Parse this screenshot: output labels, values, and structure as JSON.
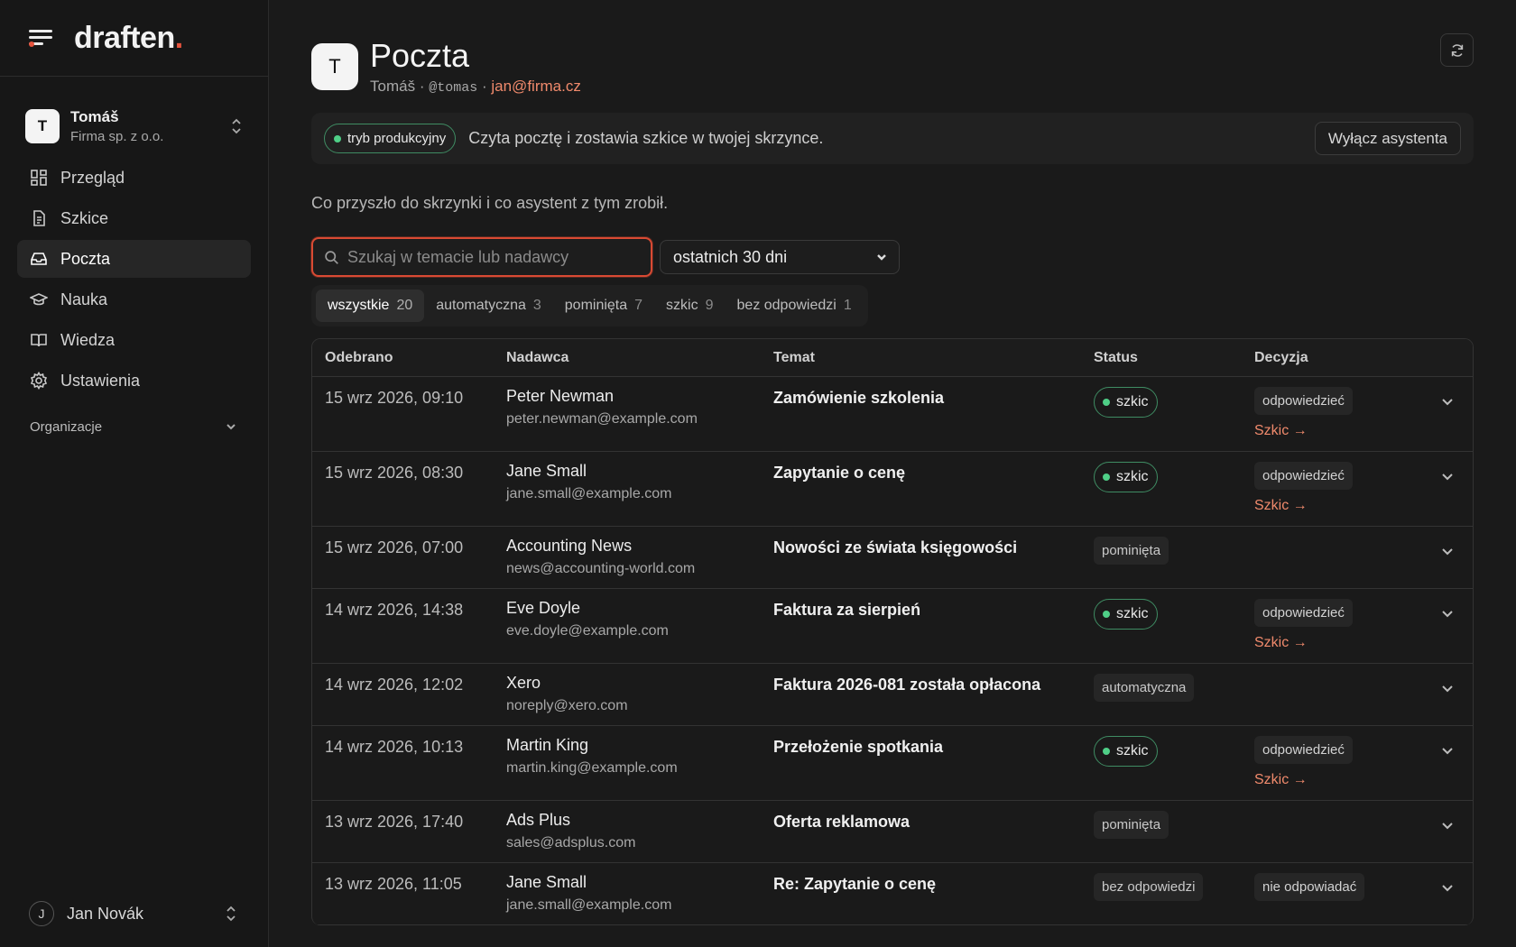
{
  "brand": {
    "name": "draften",
    "dot": "."
  },
  "org": {
    "initial": "T",
    "name": "Tomáš",
    "company": "Firma sp. z o.o."
  },
  "nav": [
    {
      "label": "Przegląd",
      "icon": "grid-icon",
      "active": false
    },
    {
      "label": "Szkice",
      "icon": "document-icon",
      "active": false
    },
    {
      "label": "Poczta",
      "icon": "inbox-icon",
      "active": true
    },
    {
      "label": "Nauka",
      "icon": "graduation-cap-icon",
      "active": false
    },
    {
      "label": "Wiedza",
      "icon": "book-icon",
      "active": false
    },
    {
      "label": "Ustawienia",
      "icon": "gear-icon",
      "active": false
    }
  ],
  "nav_section": "Organizacje",
  "user": {
    "initial": "J",
    "name": "Jan Novák"
  },
  "header": {
    "initial": "T",
    "title": "Poczta",
    "name": "Tomáš",
    "sep": "·",
    "handle": "@tomas",
    "email": "jan@firma.cz"
  },
  "banner": {
    "mode": "tryb produkcyjny",
    "text": "Czyta pocztę i zostawia szkice w twojej skrzynce.",
    "button": "Wyłącz asystenta"
  },
  "intro": "Co przyszło do skrzynki i co asystent z tym zrobił.",
  "search": {
    "placeholder": "Szukaj w temacie lub nadawcy"
  },
  "period": "ostatnich 30 dni",
  "tabs": [
    {
      "label": "wszystkie",
      "count": "20",
      "active": true
    },
    {
      "label": "automatyczna",
      "count": "3",
      "active": false
    },
    {
      "label": "pominięta",
      "count": "7",
      "active": false
    },
    {
      "label": "szkic",
      "count": "9",
      "active": false
    },
    {
      "label": "bez odpowiedzi",
      "count": "1",
      "active": false
    }
  ],
  "table": {
    "headers": [
      "Odebrano",
      "Nadawca",
      "Temat",
      "Status",
      "Decyzja"
    ],
    "rows": [
      {
        "date": "15 wrz 2026, 09:10",
        "name": "Peter Newman",
        "email": "peter.newman@example.com",
        "subject": "Zamówienie szkolenia",
        "status": "szkic",
        "decision": "odpowiedzieć",
        "link": "Szkic →"
      },
      {
        "date": "15 wrz 2026, 08:30",
        "name": "Jane Small",
        "email": "jane.small@example.com",
        "subject": "Zapytanie o cenę",
        "status": "szkic",
        "decision": "odpowiedzieć",
        "link": "Szkic →"
      },
      {
        "date": "15 wrz 2026, 07:00",
        "name": "Accounting News",
        "email": "news@accounting-world.com",
        "subject": "Nowości ze świata księgowości",
        "status": "pominięta",
        "decision": "",
        "link": ""
      },
      {
        "date": "14 wrz 2026, 14:38",
        "name": "Eve Doyle",
        "email": "eve.doyle@example.com",
        "subject": "Faktura za sierpień",
        "status": "szkic",
        "decision": "odpowiedzieć",
        "link": "Szkic →"
      },
      {
        "date": "14 wrz 2026, 12:02",
        "name": "Xero",
        "email": "noreply@xero.com",
        "subject": "Faktura 2026-081 została opłacona",
        "status": "automatyczna",
        "decision": "",
        "link": ""
      },
      {
        "date": "14 wrz 2026, 10:13",
        "name": "Martin King",
        "email": "martin.king@example.com",
        "subject": "Przełożenie spotkania",
        "status": "szkic",
        "decision": "odpowiedzieć",
        "link": "Szkic →"
      },
      {
        "date": "13 wrz 2026, 17:40",
        "name": "Ads Plus",
        "email": "sales@adsplus.com",
        "subject": "Oferta reklamowa",
        "status": "pominięta",
        "decision": "",
        "link": ""
      },
      {
        "date": "13 wrz 2026, 11:05",
        "name": "Jane Small",
        "email": "jane.small@example.com",
        "subject": "Re: Zapytanie o cenę",
        "status": "bez odpowiedzi",
        "decision": "nie odpowiadać",
        "link": ""
      }
    ]
  },
  "colors": {
    "accent": "#e5533d",
    "link": "#f08a6c",
    "status_green": "#4fcf87",
    "background": "#1a1a1a",
    "sidebar": "#171717"
  }
}
